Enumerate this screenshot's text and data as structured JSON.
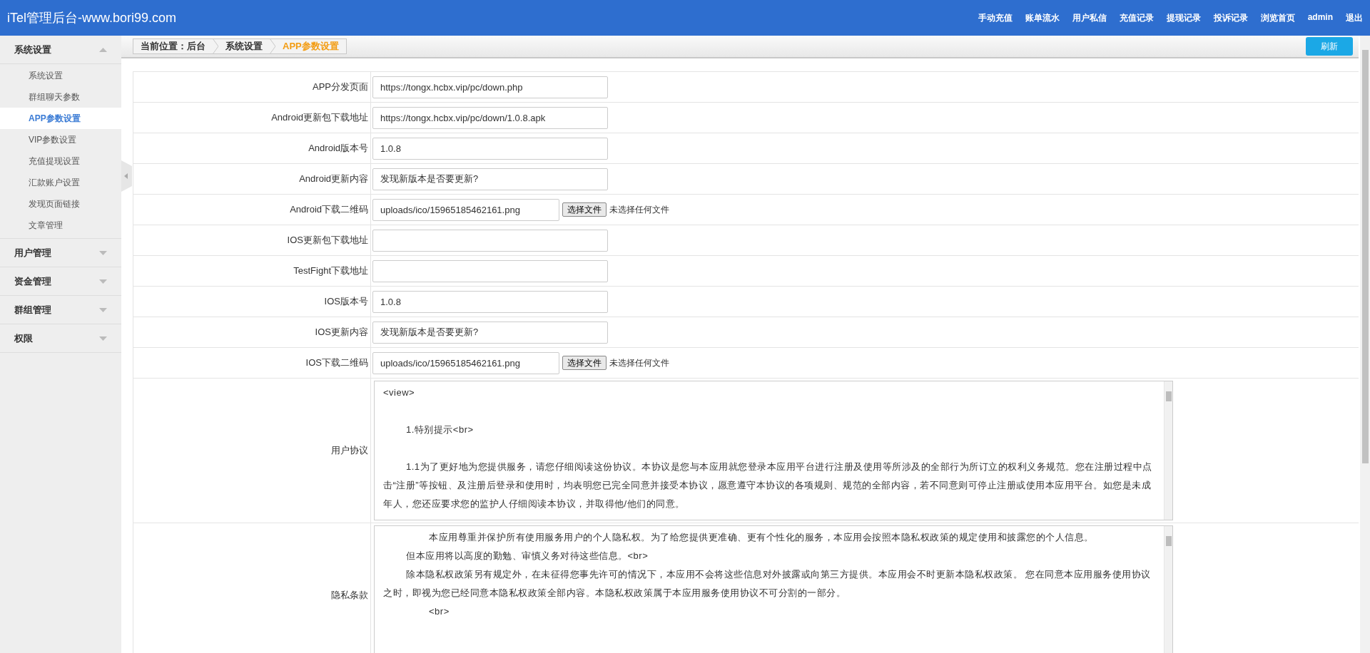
{
  "header": {
    "title": "iTel管理后台-www.bori99.com",
    "nav": [
      "手动充值",
      "账单流水",
      "用户私信",
      "充值记录",
      "提现记录",
      "投诉记录",
      "浏览首页",
      "admin",
      "退出"
    ]
  },
  "sidebar": {
    "groups": [
      {
        "label": "系统设置",
        "expanded": true,
        "items": [
          {
            "label": "系统设置",
            "selected": false
          },
          {
            "label": "群组聊天参数",
            "selected": false
          },
          {
            "label": "APP参数设置",
            "selected": true
          },
          {
            "label": "VIP参数设置",
            "selected": false
          },
          {
            "label": "充值提现设置",
            "selected": false
          },
          {
            "label": "汇款账户设置",
            "selected": false
          },
          {
            "label": "发现页面链接",
            "selected": false
          },
          {
            "label": "文章管理",
            "selected": false
          }
        ]
      },
      {
        "label": "用户管理",
        "expanded": false
      },
      {
        "label": "资金管理",
        "expanded": false
      },
      {
        "label": "群组管理",
        "expanded": false
      },
      {
        "label": "权限",
        "expanded": false
      }
    ]
  },
  "breadcrumb": {
    "items": [
      "当前位置：后台",
      "系统设置",
      "APP参数设置"
    ],
    "refresh_button": "刷新"
  },
  "form": {
    "rows": [
      {
        "kind": "text",
        "label": "APP分发页面",
        "value": "https://tongx.hcbx.vip/pc/down.php"
      },
      {
        "kind": "text",
        "label": "Android更新包下载地址",
        "value": "https://tongx.hcbx.vip/pc/down/1.0.8.apk"
      },
      {
        "kind": "text",
        "label": "Android版本号",
        "value": "1.0.8"
      },
      {
        "kind": "text",
        "label": "Android更新内容",
        "value": "发现新版本是否要更新?"
      },
      {
        "kind": "file",
        "label": "Android下载二维码",
        "value": "uploads/ico/15965185462161.png",
        "button": "选择文件",
        "status": "未选择任何文件"
      },
      {
        "kind": "text",
        "label": "IOS更新包下载地址"
      },
      {
        "kind": "text",
        "label": "TestFight下载地址"
      },
      {
        "kind": "text",
        "label": "IOS版本号",
        "value": "1.0.8"
      },
      {
        "kind": "text",
        "label": "IOS更新内容",
        "value": "发现新版本是否要更新?"
      },
      {
        "kind": "file",
        "label": "IOS下载二维码",
        "value": "uploads/ico/15965185462161.png",
        "button": "选择文件",
        "status": "未选择任何文件"
      },
      {
        "kind": "textarea",
        "label": "用户协议",
        "lines": [
          {
            "kind": "plain",
            "text": "<view>"
          },
          {
            "kind": "spaced",
            "text": "1.特别提示<br>"
          },
          {
            "kind": "spaced",
            "text": "1.1为了更好地为您提供服务，请您仔细阅读这份协议。本协议是您与本应用就您登录本应用平台进行注册及使用等所涉及的全部行为所订立的权利义务规范。您在注册过程中点击“注册”等按钮、及注册后登录和使用时，均表明您已完全同意并接受本协议，愿意遵守本协议的各项规则、规范的全部内容，若不同意则可停止注册或使用本应用平台。如您是未成年人，您还应要求您的监护人仔细阅读本协议，并取得他/他们的同意。"
          }
        ]
      },
      {
        "kind": "textarea",
        "label": "隐私条款",
        "lines": [
          {
            "kind": "deep",
            "text": "本应用尊重并保护所有使用服务用户的个人隐私权。为了给您提供更准确、更有个性化的服务，本应用会按照本隐私权政策的规定使用和披露您的个人信息。"
          },
          {
            "kind": "indent",
            "text": "但本应用将以高度的勤勉、审慎义务对待这些信息。<br>"
          },
          {
            "kind": "indent",
            "text": "除本隐私权政策另有规定外，在未征得您事先许可的情况下，本应用不会将这些信息对外披露或向第三方提供。本应用会不时更新本隐私权政策。 您在同意本应用服务使用协议之时，即视为您已经同意本隐私权政策全部内容。本隐私权政策属于本应用服务使用协议不可分割的一部分。"
          },
          {
            "kind": "deep",
            "text": "<br>"
          }
        ]
      }
    ]
  }
}
